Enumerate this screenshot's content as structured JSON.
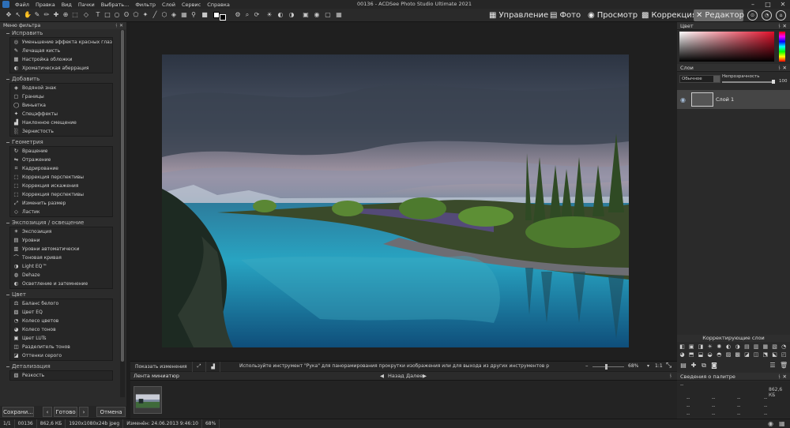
{
  "window": {
    "title": "00136 - ACDSee Photo Studio Ultimate 2021"
  },
  "menu": [
    "Файл",
    "Правка",
    "Вид",
    "Пачки",
    "Выбрать...",
    "Фильтр",
    "Слой",
    "Сервис",
    "Справка"
  ],
  "modes": {
    "manage": "Управление",
    "photo": "Фото",
    "view": "Просмотр",
    "develop": "Коррекция",
    "edit": "Редактор"
  },
  "filter_panel": {
    "title": "Меню фильтра",
    "sections": [
      {
        "title": "Исправить",
        "items": [
          "Уменьшение эффекта красных глаз",
          "Лечащая кисть",
          "Настройка обложки",
          "Хроматическая аберрация"
        ]
      },
      {
        "title": "Добавить",
        "items": [
          "Водяной знак",
          "Границы",
          "Виньетка",
          "Спецэффекты",
          "Наклонное смещение",
          "Зернистость"
        ]
      },
      {
        "title": "Геометрия",
        "items": [
          "Вращение",
          "Отражение",
          "Кадрирование",
          "Коррекция перспективы",
          "Коррекция искажения",
          "Коррекция перспективы",
          "Изменить размер",
          "Ластик"
        ]
      },
      {
        "title": "Экспозиция / освещение",
        "items": [
          "Экспозиция",
          "Уровни",
          "Уровни автоматически",
          "Тоновая кривая",
          "Light EQ™",
          "Dehaze",
          "Осветление и затемнение"
        ]
      },
      {
        "title": "Цвет",
        "items": [
          "Баланс белого",
          "Цвет EQ",
          "Колесо цветов",
          "Колесо тонов",
          "Цвет LUTs",
          "Разделитель тонов",
          "Оттенки серого"
        ]
      },
      {
        "title": "Детализация",
        "items": [
          "Резкость"
        ]
      }
    ],
    "buttons": {
      "save": "Сохрани...",
      "done": "Готово",
      "cancel": "Отмена"
    }
  },
  "viewer": {
    "show_changes": "Показать изменения",
    "hint": "Используйте инструмент \"Рука\" для панорамирования прокрутки изображения или для выхода из других инструментов рисования или выделе...",
    "zoom": "68%",
    "ratio": "1:1",
    "zoom_level": 0.68
  },
  "filmstrip": {
    "title": "Лента миниатюр",
    "back": "Назад",
    "forward": "Далее"
  },
  "right_panel": {
    "color_title": "Цвет",
    "layers_title": "Слои",
    "blend_mode": "Обычное",
    "opacity_label": "Непрозрачность",
    "opacity_value": "100",
    "layer_name": "Слой 1",
    "adjust_title": "Корректирующие слои",
    "palette_title": "Сведения о палитре",
    "palette_size": "862,6 КБ",
    "palette_dash": "--"
  },
  "status": {
    "index": "1/1",
    "name": "00136",
    "size": "862,6 КБ",
    "dims": "1920x1080x24b jpeg",
    "modified": "Изменён: 24.06.2013 9:46:10",
    "zoom": "68%"
  },
  "colors": {
    "accent": "#2d6fb8",
    "active_mode": "#6b6b6b",
    "panel": "#2b2b2b",
    "background": "#1e1e1e"
  }
}
